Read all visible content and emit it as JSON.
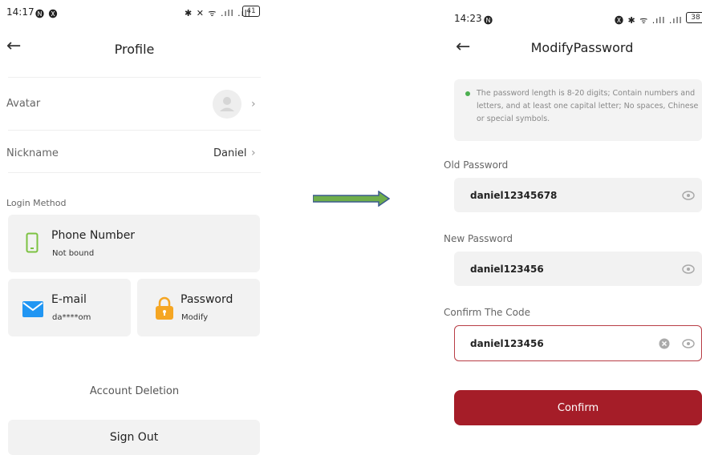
{
  "left": {
    "status_time": "14:17",
    "status_left_icons": "🅝 🅧",
    "status_right_icons": "✱ ✕ ᯤ .ıll .ıll",
    "battery": "41",
    "title": "Profile",
    "avatar_label": "Avatar",
    "nickname_label": "Nickname",
    "nickname_value": "Daniel",
    "login_method_label": "Login Method",
    "phone": {
      "title": "Phone Number",
      "sub": "Not bound"
    },
    "email": {
      "title": "E-mail",
      "sub": "da****om"
    },
    "password": {
      "title": "Password",
      "sub": "Modify"
    },
    "account_deletion": "Account Deletion",
    "sign_out": "Sign Out"
  },
  "arrow": {
    "fill": "#6fae4b",
    "stroke": "#3b5a8f"
  },
  "right": {
    "status_time": "14:23",
    "status_left_icons": "🅝",
    "status_right_icons": "🅧 ✱ ᯤ .ıll .ıll",
    "battery": "38",
    "title": "ModifyPassword",
    "hint": "The password length is 8-20 digits; Contain numbers and letters, and at least one capital letter; No spaces, Chinese or special symbols.",
    "old_password_label": "Old Password",
    "old_password_value": "daniel12345678",
    "new_password_label": "New Password",
    "new_password_value": "daniel123456",
    "confirm_code_label": "Confirm The Code",
    "confirm_code_value": "daniel123456",
    "confirm_button": "Confirm"
  },
  "colors": {
    "accent": "#a51d28",
    "hint_dot": "#4caf50",
    "phone_icon": "#7cc242",
    "mail_icon": "#2196f3",
    "lock_icon": "#f5a623"
  }
}
